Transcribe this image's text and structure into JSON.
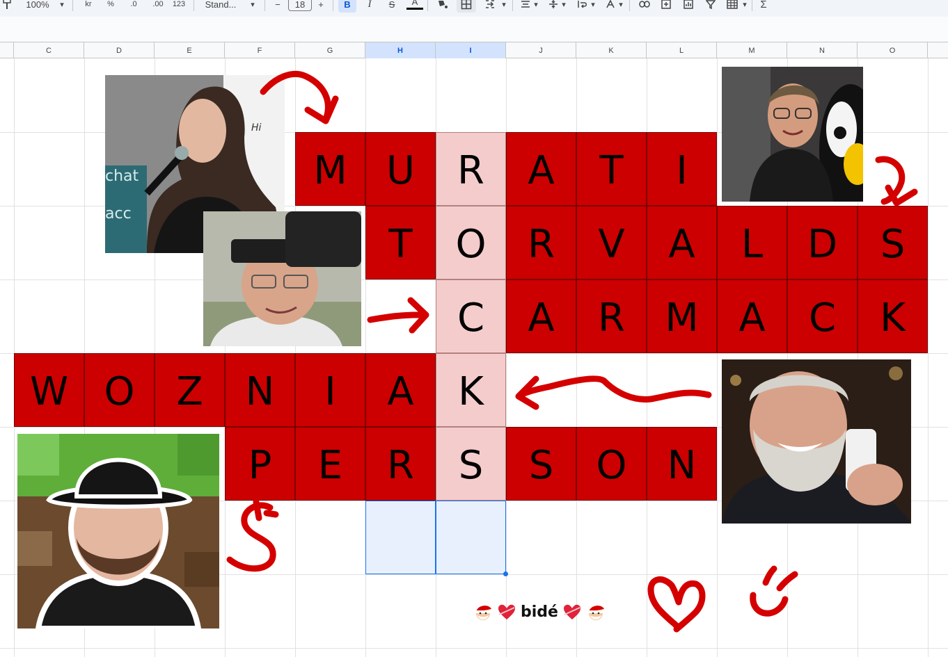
{
  "toolbar": {
    "zoom": "100%",
    "currency": "kr",
    "percent": "%",
    "decrease_decimals": ".0",
    "increase_decimals": ".00",
    "number_format": "123",
    "font_name": "Stand...",
    "font_size": "18",
    "minus": "−",
    "plus": "+",
    "bold": "B",
    "italic": "I",
    "strikethrough": "S",
    "text_color": "A",
    "sum": "Σ"
  },
  "columns": [
    "C",
    "D",
    "E",
    "F",
    "G",
    "H",
    "I",
    "J",
    "K",
    "L",
    "M",
    "N",
    "O"
  ],
  "selected_columns": [
    "H",
    "I"
  ],
  "crossword": {
    "words": [
      {
        "word": "MURATI",
        "letters": [
          "M",
          "U",
          "R",
          "A",
          "T",
          "I"
        ]
      },
      {
        "word": "TORVALDS",
        "letters": [
          "T",
          "O",
          "R",
          "V",
          "A",
          "L",
          "D",
          "S"
        ]
      },
      {
        "word": "CARMACK",
        "letters": [
          "C",
          "A",
          "R",
          "M",
          "A",
          "C",
          "K"
        ]
      },
      {
        "word": "WOZNIAK",
        "letters": [
          "W",
          "O",
          "Z",
          "N",
          "I",
          "A",
          "K"
        ]
      },
      {
        "word": "PERSSON",
        "letters": [
          "P",
          "E",
          "R",
          "S",
          "S",
          "O",
          "N"
        ]
      }
    ],
    "answer_column": "ROCKS",
    "colors": {
      "filled": "#cc0000",
      "answer": "#f4cccc",
      "ink": "#cc0000"
    }
  },
  "photos": [
    {
      "name": "photo-murati",
      "depicts": "woman speaking into microphone",
      "overlay_text": [
        "chat",
        "acc",
        "Hi"
      ]
    },
    {
      "name": "photo-torvalds",
      "depicts": "smiling man with glasses next to penguin mascot"
    },
    {
      "name": "photo-carmack",
      "depicts": "man with glasses wearing VR headset on head"
    },
    {
      "name": "photo-wozniak",
      "depicts": "bearded man holding a phone"
    },
    {
      "name": "photo-persson",
      "depicts": "bearded man in black fedora on pixel background"
    }
  ],
  "caption": {
    "text": "bidé",
    "emoji": [
      "santa",
      "heart",
      "heart",
      "santa"
    ]
  }
}
